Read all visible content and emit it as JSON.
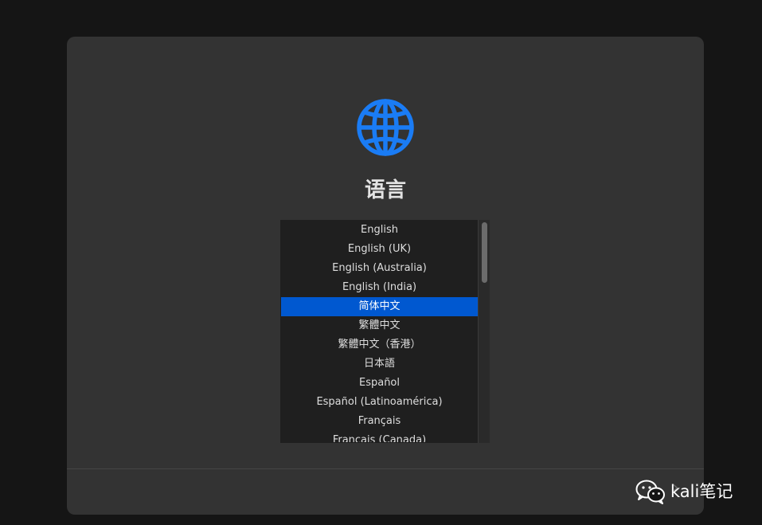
{
  "page": {
    "title": "语言"
  },
  "icons": {
    "globe": "globe-icon",
    "next": "chevron-right-icon",
    "watermark": "wechat-icon"
  },
  "colors": {
    "window_bg": "#333333",
    "list_bg": "#1f1f1f",
    "selection": "#0058d0",
    "accent_globe": "#1a7cf5"
  },
  "language_list": {
    "selected": "简体中文",
    "items": [
      "English",
      "English (UK)",
      "English (Australia)",
      "English (India)",
      "简体中文",
      "繁體中文",
      "繁體中文（香港）",
      "日本語",
      "Español",
      "Español (Latinoamérica)",
      "Français",
      "Français (Canada)"
    ]
  },
  "footer": {
    "next_label": "›"
  },
  "watermark": {
    "text": "kali笔记"
  }
}
